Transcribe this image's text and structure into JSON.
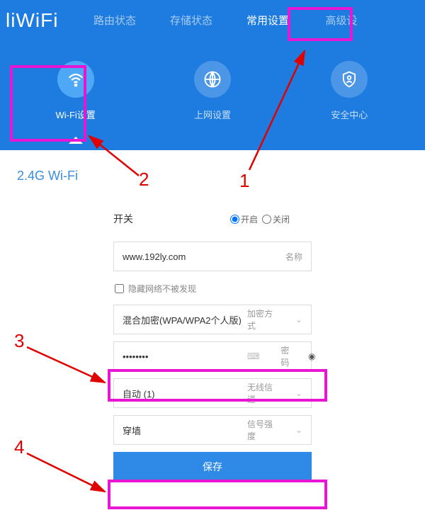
{
  "logo": "liWiFi",
  "nav": [
    {
      "label": "路由状态",
      "active": false
    },
    {
      "label": "存储状态",
      "active": false
    },
    {
      "label": "常用设置",
      "active": true
    },
    {
      "label": "高级设",
      "active": false
    }
  ],
  "subtabs": [
    {
      "label": "Wi-Fi设置",
      "icon": "wifi",
      "active": true
    },
    {
      "label": "上网设置",
      "icon": "globe",
      "active": false
    },
    {
      "label": "安全中心",
      "icon": "shield",
      "active": false
    }
  ],
  "section_title": "2.4G Wi-Fi",
  "form": {
    "switch_label": "开关",
    "radio_on": "开启",
    "radio_off": "关闭",
    "name_value": "www.192ly.com",
    "name_suffix": "名称",
    "hide_ssid_label": "隐藏网络不被发现",
    "encryption_value": "混合加密(WPA/WPA2个人版)",
    "encryption_suffix": "加密方式",
    "password_value": "••••••••",
    "password_suffix": "密码",
    "channel_value": "自动 (1)",
    "channel_suffix": "无线信道",
    "strength_value": "穿墙",
    "strength_suffix": "信号强度",
    "save_label": "保存"
  },
  "annotations": {
    "n1": "1",
    "n2": "2",
    "n3": "3",
    "n4": "4"
  }
}
